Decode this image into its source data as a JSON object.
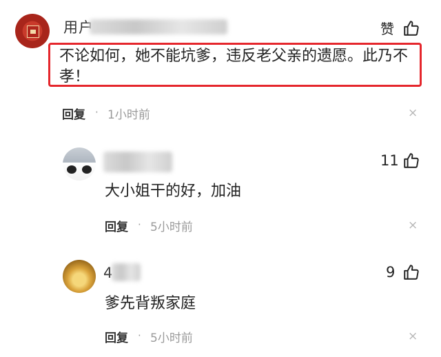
{
  "comments": [
    {
      "name_visible": "用户",
      "text": "不论如何，她不能坑爹，违反老父亲的遗愿。此乃不孝！",
      "text_line1": "不论如何，她不能坑爹，违反老父亲的遗愿。此乃不",
      "text_line2": "孝！",
      "like_label": "赞",
      "reply_label": "回复",
      "separator": "·",
      "time": "1小时前",
      "close_glyph": "×"
    },
    {
      "text": "大小姐干的好，加油",
      "likes": "11",
      "reply_label": "回复",
      "separator": "·",
      "time": "5小时前",
      "close_glyph": "×"
    },
    {
      "name_visible": "4",
      "text": "爹先背叛家庭",
      "likes": "9",
      "reply_label": "回复",
      "separator": "·",
      "time": "5小时前",
      "close_glyph": "×"
    }
  ],
  "colors": {
    "highlight_border": "#e5262c",
    "muted_text": "#9a9a9a"
  },
  "icons": [
    "thumbs-up-icon",
    "close-icon"
  ]
}
